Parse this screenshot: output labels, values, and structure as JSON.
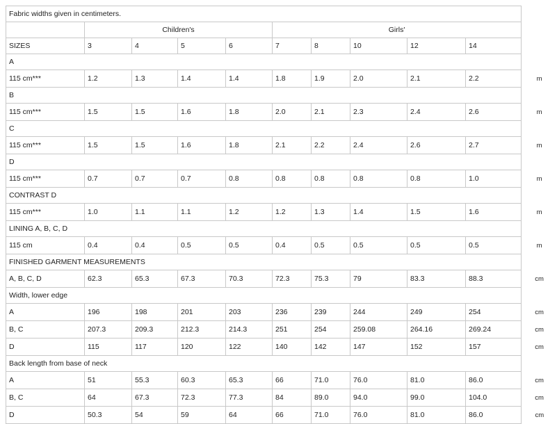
{
  "note": "Fabric widths given in centimeters.",
  "groups": {
    "children": "Children's",
    "girls": "Girls'"
  },
  "sizes_label": "SIZES",
  "sizes": [
    "3",
    "4",
    "5",
    "6",
    "7",
    "8",
    "10",
    "12",
    "14"
  ],
  "sections": [
    {
      "header": "A",
      "rows": [
        {
          "label": "115 cm***",
          "values": [
            "1.2",
            "1.3",
            "1.4",
            "1.4",
            "1.8",
            "1.9",
            "2.0",
            "2.1",
            "2.2"
          ],
          "unit": "m"
        }
      ]
    },
    {
      "header": "B",
      "rows": [
        {
          "label": "115 cm***",
          "values": [
            "1.5",
            "1.5",
            "1.6",
            "1.8",
            "2.0",
            "2.1",
            "2.3",
            "2.4",
            "2.6"
          ],
          "unit": "m"
        }
      ]
    },
    {
      "header": "C",
      "rows": [
        {
          "label": "115 cm***",
          "values": [
            "1.5",
            "1.5",
            "1.6",
            "1.8",
            "2.1",
            "2.2",
            "2.4",
            "2.6",
            "2.7"
          ],
          "unit": "m"
        }
      ]
    },
    {
      "header": "D",
      "rows": [
        {
          "label": "115 cm***",
          "values": [
            "0.7",
            "0.7",
            "0.7",
            "0.8",
            "0.8",
            "0.8",
            "0.8",
            "0.8",
            "1.0"
          ],
          "unit": "m"
        }
      ]
    },
    {
      "header": "CONTRAST D",
      "rows": [
        {
          "label": "115 cm***",
          "values": [
            "1.0",
            "1.1",
            "1.1",
            "1.2",
            "1.2",
            "1.3",
            "1.4",
            "1.5",
            "1.6"
          ],
          "unit": "m"
        }
      ]
    },
    {
      "header": "LINING A, B, C, D",
      "rows": [
        {
          "label": "115 cm",
          "values": [
            "0.4",
            "0.4",
            "0.5",
            "0.5",
            "0.4",
            "0.5",
            "0.5",
            "0.5",
            "0.5"
          ],
          "unit": "m"
        }
      ]
    },
    {
      "header": "FINISHED GARMENT MEASUREMENTS",
      "rows": [
        {
          "label": "A, B, C, D",
          "values": [
            "62.3",
            "65.3",
            "67.3",
            "70.3",
            "72.3",
            "75.3",
            "79",
            "83.3",
            "88.3"
          ],
          "unit": "cm"
        }
      ]
    },
    {
      "header": "Width, lower edge",
      "rows": [
        {
          "label": "A",
          "values": [
            "196",
            "198",
            "201",
            "203",
            "236",
            "239",
            "244",
            "249",
            "254"
          ],
          "unit": "cm"
        },
        {
          "label": "B, C",
          "values": [
            "207.3",
            "209.3",
            "212.3",
            "214.3",
            "251",
            "254",
            "259.08",
            "264.16",
            "269.24"
          ],
          "unit": "cm"
        },
        {
          "label": "D",
          "values": [
            "115",
            "117",
            "120",
            "122",
            "140",
            "142",
            "147",
            "152",
            "157"
          ],
          "unit": "cm"
        }
      ]
    },
    {
      "header": "Back length from base of neck",
      "rows": [
        {
          "label": "A",
          "values": [
            "51",
            "55.3",
            "60.3",
            "65.3",
            "66",
            "71.0",
            "76.0",
            "81.0",
            "86.0"
          ],
          "unit": "cm"
        },
        {
          "label": "B, C",
          "values": [
            "64",
            "67.3",
            "72.3",
            "77.3",
            "84",
            "89.0",
            "94.0",
            "99.0",
            "104.0"
          ],
          "unit": "cm"
        },
        {
          "label": "D",
          "values": [
            "50.3",
            "54",
            "59",
            "64",
            "66",
            "71.0",
            "76.0",
            "81.0",
            "86.0"
          ],
          "unit": "cm"
        }
      ]
    }
  ]
}
